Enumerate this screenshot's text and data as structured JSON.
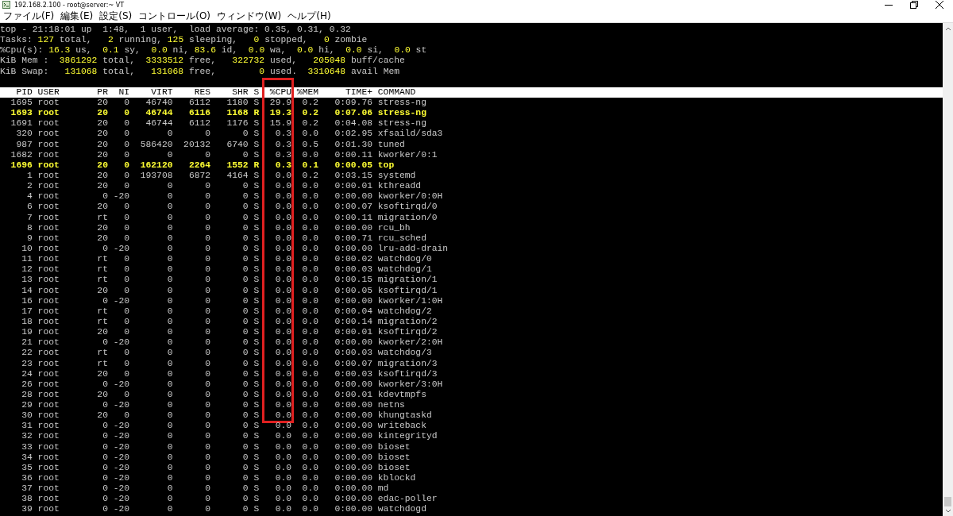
{
  "window": {
    "title": "192.168.2.100 - root@server:~ VT"
  },
  "menu": [
    "ファイル(F)",
    "編集(E)",
    "設定(S)",
    "コントロール(O)",
    "ウィンドウ(W)",
    "ヘルプ(H)"
  ],
  "summary": [
    [
      {
        "text": "top - 21:18:01 up  1:48,  1 user,  load average: 0.35, 0.31, 0.32",
        "kind": "label"
      }
    ],
    [
      {
        "text": "Tasks: ",
        "kind": "label"
      },
      {
        "text": "127",
        "kind": "value"
      },
      {
        "text": " total,   ",
        "kind": "label"
      },
      {
        "text": "2",
        "kind": "value"
      },
      {
        "text": " running, ",
        "kind": "label"
      },
      {
        "text": "125",
        "kind": "value"
      },
      {
        "text": " sleeping,   ",
        "kind": "label"
      },
      {
        "text": "0",
        "kind": "value"
      },
      {
        "text": " stopped,   ",
        "kind": "label"
      },
      {
        "text": "0",
        "kind": "value"
      },
      {
        "text": " zombie",
        "kind": "label"
      }
    ],
    [
      {
        "text": "%Cpu(s): ",
        "kind": "label"
      },
      {
        "text": "16.3",
        "kind": "value"
      },
      {
        "text": " us,  ",
        "kind": "label"
      },
      {
        "text": "0.1",
        "kind": "value"
      },
      {
        "text": " sy,  ",
        "kind": "label"
      },
      {
        "text": "0.0",
        "kind": "value"
      },
      {
        "text": " ni, ",
        "kind": "label"
      },
      {
        "text": "83.6",
        "kind": "value"
      },
      {
        "text": " id,  ",
        "kind": "label"
      },
      {
        "text": "0.0",
        "kind": "value"
      },
      {
        "text": " wa,  ",
        "kind": "label"
      },
      {
        "text": "0.0",
        "kind": "value"
      },
      {
        "text": " hi,  ",
        "kind": "label"
      },
      {
        "text": "0.0",
        "kind": "value"
      },
      {
        "text": " si,  ",
        "kind": "label"
      },
      {
        "text": "0.0",
        "kind": "value"
      },
      {
        "text": " st",
        "kind": "label"
      }
    ],
    [
      {
        "text": "KiB Mem :  ",
        "kind": "label"
      },
      {
        "text": "3861292",
        "kind": "value"
      },
      {
        "text": " total,  ",
        "kind": "label"
      },
      {
        "text": "3333512",
        "kind": "value"
      },
      {
        "text": " free,   ",
        "kind": "label"
      },
      {
        "text": "322732",
        "kind": "value"
      },
      {
        "text": " used,   ",
        "kind": "label"
      },
      {
        "text": "205048",
        "kind": "value"
      },
      {
        "text": " buff/cache",
        "kind": "label"
      }
    ],
    [
      {
        "text": "KiB Swap:   ",
        "kind": "label"
      },
      {
        "text": "131068",
        "kind": "value"
      },
      {
        "text": " total,   ",
        "kind": "label"
      },
      {
        "text": "131068",
        "kind": "value"
      },
      {
        "text": " free,        ",
        "kind": "label"
      },
      {
        "text": "0",
        "kind": "value"
      },
      {
        "text": " used.  ",
        "kind": "label"
      },
      {
        "text": "3310648",
        "kind": "value"
      },
      {
        "text": " avail Mem",
        "kind": "label"
      }
    ]
  ],
  "table": {
    "columns": [
      {
        "label": "PID",
        "outlined": false
      },
      {
        "label": "USER",
        "outlined": false
      },
      {
        "label": "PR",
        "outlined": false
      },
      {
        "label": "NI",
        "outlined": false
      },
      {
        "label": "VIRT",
        "outlined": false
      },
      {
        "label": "RES",
        "outlined": false
      },
      {
        "label": "SHR",
        "outlined": false
      },
      {
        "label": "S",
        "outlined": false
      },
      {
        "label": "%CPU",
        "outlined": true
      },
      {
        "label": "%MEM",
        "outlined": false
      },
      {
        "label": "TIME+",
        "outlined": false
      },
      {
        "label": "COMMAND",
        "outlined": false
      }
    ],
    "rows": [
      {
        "cells": [
          "1695",
          "root",
          "20",
          "0",
          "46740",
          "6112",
          "1180",
          "S",
          "29.9",
          "0.2",
          "0:09.76",
          "stress-ng"
        ],
        "highlighted": false,
        "outlined": true
      },
      {
        "cells": [
          "1693",
          "root",
          "20",
          "0",
          "46744",
          "6116",
          "1168",
          "R",
          "19.3",
          "0.2",
          "0:07.06",
          "stress-ng"
        ],
        "highlighted": true,
        "outlined": true
      },
      {
        "cells": [
          "1691",
          "root",
          "20",
          "0",
          "46744",
          "6112",
          "1176",
          "S",
          "15.9",
          "0.2",
          "0:04.08",
          "stress-ng"
        ],
        "highlighted": false,
        "outlined": true
      },
      {
        "cells": [
          "320",
          "root",
          "20",
          "0",
          "0",
          "0",
          "0",
          "S",
          "0.3",
          "0.0",
          "0:02.95",
          "xfsaild/sda3"
        ],
        "highlighted": false,
        "outlined": true
      },
      {
        "cells": [
          "987",
          "root",
          "20",
          "0",
          "586420",
          "20132",
          "6740",
          "S",
          "0.3",
          "0.5",
          "0:01.30",
          "tuned"
        ],
        "highlighted": false,
        "outlined": true
      },
      {
        "cells": [
          "1682",
          "root",
          "20",
          "0",
          "0",
          "0",
          "0",
          "S",
          "0.3",
          "0.0",
          "0:00.11",
          "kworker/0:1"
        ],
        "highlighted": false,
        "outlined": true
      },
      {
        "cells": [
          "1696",
          "root",
          "20",
          "0",
          "162120",
          "2264",
          "1552",
          "R",
          "0.3",
          "0.1",
          "0:00.05",
          "top"
        ],
        "highlighted": true,
        "outlined": true
      },
      {
        "cells": [
          "1",
          "root",
          "20",
          "0",
          "193708",
          "6872",
          "4164",
          "S",
          "0.0",
          "0.2",
          "0:03.15",
          "systemd"
        ],
        "highlighted": false,
        "outlined": true
      },
      {
        "cells": [
          "2",
          "root",
          "20",
          "0",
          "0",
          "0",
          "0",
          "S",
          "0.0",
          "0.0",
          "0:00.01",
          "kthreadd"
        ],
        "highlighted": false,
        "outlined": true
      },
      {
        "cells": [
          "4",
          "root",
          "0",
          "-20",
          "0",
          "0",
          "0",
          "S",
          "0.0",
          "0.0",
          "0:00.00",
          "kworker/0:0H"
        ],
        "highlighted": false,
        "outlined": true
      },
      {
        "cells": [
          "6",
          "root",
          "20",
          "0",
          "0",
          "0",
          "0",
          "S",
          "0.0",
          "0.0",
          "0:00.07",
          "ksoftirqd/0"
        ],
        "highlighted": false,
        "outlined": true
      },
      {
        "cells": [
          "7",
          "root",
          "rt",
          "0",
          "0",
          "0",
          "0",
          "S",
          "0.0",
          "0.0",
          "0:00.11",
          "migration/0"
        ],
        "highlighted": false,
        "outlined": true
      },
      {
        "cells": [
          "8",
          "root",
          "20",
          "0",
          "0",
          "0",
          "0",
          "S",
          "0.0",
          "0.0",
          "0:00.00",
          "rcu_bh"
        ],
        "highlighted": false,
        "outlined": true
      },
      {
        "cells": [
          "9",
          "root",
          "20",
          "0",
          "0",
          "0",
          "0",
          "S",
          "0.0",
          "0.0",
          "0:00.71",
          "rcu_sched"
        ],
        "highlighted": false,
        "outlined": true
      },
      {
        "cells": [
          "10",
          "root",
          "0",
          "-20",
          "0",
          "0",
          "0",
          "S",
          "0.0",
          "0.0",
          "0:00.00",
          "lru-add-drain"
        ],
        "highlighted": false,
        "outlined": true
      },
      {
        "cells": [
          "11",
          "root",
          "rt",
          "0",
          "0",
          "0",
          "0",
          "S",
          "0.0",
          "0.0",
          "0:00.02",
          "watchdog/0"
        ],
        "highlighted": false,
        "outlined": true
      },
      {
        "cells": [
          "12",
          "root",
          "rt",
          "0",
          "0",
          "0",
          "0",
          "S",
          "0.0",
          "0.0",
          "0:00.03",
          "watchdog/1"
        ],
        "highlighted": false,
        "outlined": true
      },
      {
        "cells": [
          "13",
          "root",
          "rt",
          "0",
          "0",
          "0",
          "0",
          "S",
          "0.0",
          "0.0",
          "0:00.15",
          "migration/1"
        ],
        "highlighted": false,
        "outlined": true
      },
      {
        "cells": [
          "14",
          "root",
          "20",
          "0",
          "0",
          "0",
          "0",
          "S",
          "0.0",
          "0.0",
          "0:00.05",
          "ksoftirqd/1"
        ],
        "highlighted": false,
        "outlined": true
      },
      {
        "cells": [
          "16",
          "root",
          "0",
          "-20",
          "0",
          "0",
          "0",
          "S",
          "0.0",
          "0.0",
          "0:00.00",
          "kworker/1:0H"
        ],
        "highlighted": false,
        "outlined": true
      },
      {
        "cells": [
          "17",
          "root",
          "rt",
          "0",
          "0",
          "0",
          "0",
          "S",
          "0.0",
          "0.0",
          "0:00.04",
          "watchdog/2"
        ],
        "highlighted": false,
        "outlined": true
      },
      {
        "cells": [
          "18",
          "root",
          "rt",
          "0",
          "0",
          "0",
          "0",
          "S",
          "0.0",
          "0.0",
          "0:00.14",
          "migration/2"
        ],
        "highlighted": false,
        "outlined": true
      },
      {
        "cells": [
          "19",
          "root",
          "20",
          "0",
          "0",
          "0",
          "0",
          "S",
          "0.0",
          "0.0",
          "0:00.01",
          "ksoftirqd/2"
        ],
        "highlighted": false,
        "outlined": true
      },
      {
        "cells": [
          "21",
          "root",
          "0",
          "-20",
          "0",
          "0",
          "0",
          "S",
          "0.0",
          "0.0",
          "0:00.00",
          "kworker/2:0H"
        ],
        "highlighted": false,
        "outlined": true
      },
      {
        "cells": [
          "22",
          "root",
          "rt",
          "0",
          "0",
          "0",
          "0",
          "S",
          "0.0",
          "0.0",
          "0:00.03",
          "watchdog/3"
        ],
        "highlighted": false,
        "outlined": true
      },
      {
        "cells": [
          "23",
          "root",
          "rt",
          "0",
          "0",
          "0",
          "0",
          "S",
          "0.0",
          "0.0",
          "0:00.07",
          "migration/3"
        ],
        "highlighted": false,
        "outlined": true
      },
      {
        "cells": [
          "24",
          "root",
          "20",
          "0",
          "0",
          "0",
          "0",
          "S",
          "0.0",
          "0.0",
          "0:00.03",
          "ksoftirqd/3"
        ],
        "highlighted": false,
        "outlined": true
      },
      {
        "cells": [
          "26",
          "root",
          "0",
          "-20",
          "0",
          "0",
          "0",
          "S",
          "0.0",
          "0.0",
          "0:00.00",
          "kworker/3:0H"
        ],
        "highlighted": false,
        "outlined": true
      },
      {
        "cells": [
          "28",
          "root",
          "20",
          "0",
          "0",
          "0",
          "0",
          "S",
          "0.0",
          "0.0",
          "0:00.01",
          "kdevtmpfs"
        ],
        "highlighted": false,
        "outlined": true
      },
      {
        "cells": [
          "29",
          "root",
          "0",
          "-20",
          "0",
          "0",
          "0",
          "S",
          "0.0",
          "0.0",
          "0:00.00",
          "netns"
        ],
        "highlighted": false,
        "outlined": true
      },
      {
        "cells": [
          "30",
          "root",
          "20",
          "0",
          "0",
          "0",
          "0",
          "S",
          "0.0",
          "0.0",
          "0:00.00",
          "khungtaskd"
        ],
        "highlighted": false,
        "outlined": true
      },
      {
        "cells": [
          "31",
          "root",
          "0",
          "-20",
          "0",
          "0",
          "0",
          "S",
          "0.0",
          "0.0",
          "0:00.00",
          "writeback"
        ],
        "highlighted": false,
        "outlined": false
      },
      {
        "cells": [
          "32",
          "root",
          "0",
          "-20",
          "0",
          "0",
          "0",
          "S",
          "0.0",
          "0.0",
          "0:00.00",
          "kintegrityd"
        ],
        "highlighted": false,
        "outlined": false
      },
      {
        "cells": [
          "33",
          "root",
          "0",
          "-20",
          "0",
          "0",
          "0",
          "S",
          "0.0",
          "0.0",
          "0:00.00",
          "bioset"
        ],
        "highlighted": false,
        "outlined": false
      },
      {
        "cells": [
          "34",
          "root",
          "0",
          "-20",
          "0",
          "0",
          "0",
          "S",
          "0.0",
          "0.0",
          "0:00.00",
          "bioset"
        ],
        "highlighted": false,
        "outlined": false
      },
      {
        "cells": [
          "35",
          "root",
          "0",
          "-20",
          "0",
          "0",
          "0",
          "S",
          "0.0",
          "0.0",
          "0:00.00",
          "bioset"
        ],
        "highlighted": false,
        "outlined": false
      },
      {
        "cells": [
          "36",
          "root",
          "0",
          "-20",
          "0",
          "0",
          "0",
          "S",
          "0.0",
          "0.0",
          "0:00.00",
          "kblockd"
        ],
        "highlighted": false,
        "outlined": false
      },
      {
        "cells": [
          "37",
          "root",
          "0",
          "-20",
          "0",
          "0",
          "0",
          "S",
          "0.0",
          "0.0",
          "0:00.00",
          "md"
        ],
        "highlighted": false,
        "outlined": false
      },
      {
        "cells": [
          "38",
          "root",
          "0",
          "-20",
          "0",
          "0",
          "0",
          "S",
          "0.0",
          "0.0",
          "0:00.00",
          "edac-poller"
        ],
        "highlighted": false,
        "outlined": false
      },
      {
        "cells": [
          "39",
          "root",
          "0",
          "-20",
          "0",
          "0",
          "0",
          "S",
          "0.0",
          "0.0",
          "0:00.00",
          "watchdogd"
        ],
        "highlighted": false,
        "outlined": false
      }
    ]
  }
}
